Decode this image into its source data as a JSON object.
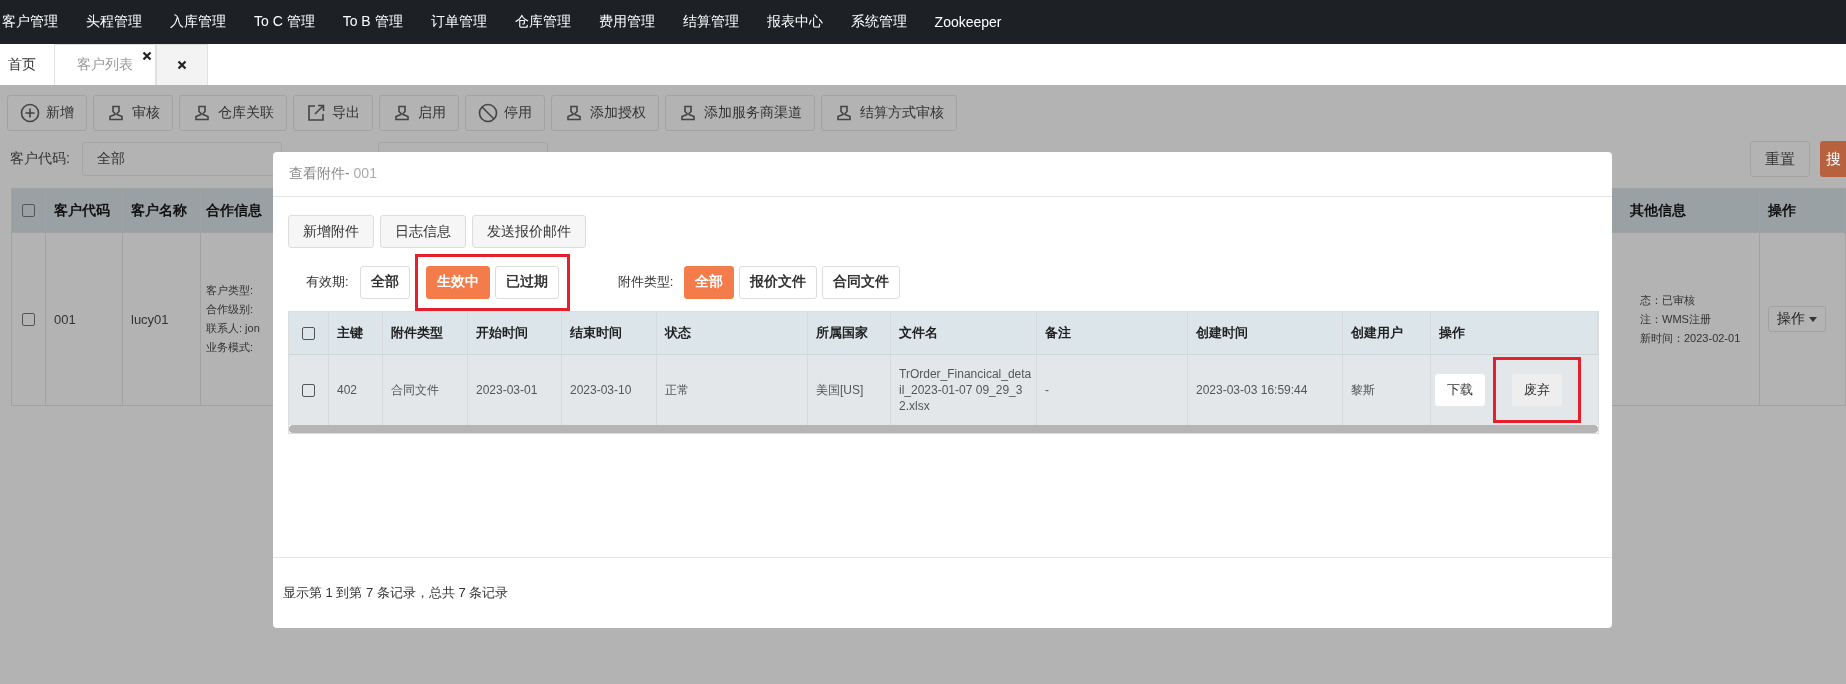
{
  "top_nav": [
    "客户管理",
    "头程管理",
    "入库管理",
    "To C 管理",
    "To B 管理",
    "订单管理",
    "仓库管理",
    "费用管理",
    "结算管理",
    "报表中心",
    "系统管理",
    "Zookeeper"
  ],
  "page_tabs": [
    {
      "label": "首页",
      "selected": false,
      "closable": false
    },
    {
      "label": "客户列表",
      "selected": true,
      "closable": true
    },
    {
      "selected": false,
      "closable": true
    }
  ],
  "toolbar": [
    {
      "label": "新增",
      "kind": "add"
    },
    {
      "label": "审核",
      "kind": "user"
    },
    {
      "label": "仓库关联",
      "kind": "user"
    },
    {
      "label": "导出",
      "kind": "export"
    },
    {
      "label": "启用",
      "kind": "user"
    },
    {
      "label": "停用",
      "kind": "disable"
    },
    {
      "label": "添加授权",
      "kind": "user"
    },
    {
      "label": "添加服务商渠道",
      "kind": "user"
    },
    {
      "label": "结算方式审核",
      "kind": "user"
    }
  ],
  "filter": {
    "label": "客户代码:",
    "value": "全部"
  },
  "reset_button": "重置",
  "search_button": "搜",
  "customer_table": {
    "all_checked": false,
    "columns_left": [
      "客户代码",
      "客户名称",
      "合作信息"
    ],
    "columns_right": [
      "其他信息",
      "操作"
    ],
    "rows": [
      {
        "checked": false,
        "code": "001",
        "name": "lucy01",
        "coop_info": [
          "客户类型:",
          "合作级别:",
          "联系人: jon",
          "业务模式:"
        ],
        "other_info": [
          "态：已审核",
          "注：WMS注册",
          "新时间：2023-02-01"
        ],
        "action": "操作"
      }
    ]
  },
  "modal": {
    "title": "查看附件-",
    "title_id": "001",
    "actions": [
      "新增附件",
      "日志信息",
      "发送报价邮件"
    ],
    "validity": {
      "label": "有效期:",
      "options": [
        {
          "label": "全部",
          "selected": false,
          "highlighted": false
        },
        {
          "label": "生效中",
          "selected": true,
          "highlighted": true
        },
        {
          "label": "已过期",
          "selected": false,
          "highlighted": true
        }
      ]
    },
    "attachment_type": {
      "label": "附件类型:",
      "options": [
        {
          "label": "全部",
          "selected": true,
          "highlighted": false
        },
        {
          "label": "报价文件",
          "selected": false,
          "highlighted": false
        },
        {
          "label": "合同文件",
          "selected": false,
          "highlighted": false
        }
      ]
    },
    "table": {
      "all_checked": false,
      "columns": [
        "主键",
        "附件类型",
        "开始时间",
        "结束时间",
        "状态",
        "所属国家",
        "文件名",
        "备注",
        "创建时间",
        "创建用户",
        "操作"
      ],
      "rows": [
        {
          "checked": false,
          "cells": [
            "402",
            "合同文件",
            "2023-03-01",
            "2023-03-10",
            "正常",
            "美国[US]",
            "TrOrder_Financical_detail_2023-01-07 09_29_32.xlsx",
            "-",
            "2023-03-03 16:59:44",
            "黎斯"
          ],
          "actions": [
            {
              "label": "下载",
              "highlighted": false
            },
            {
              "label": "废弃",
              "highlighted": true
            }
          ]
        }
      ]
    },
    "footer": "显示第 1 到第 7 条记录，总共 7 条记录"
  }
}
